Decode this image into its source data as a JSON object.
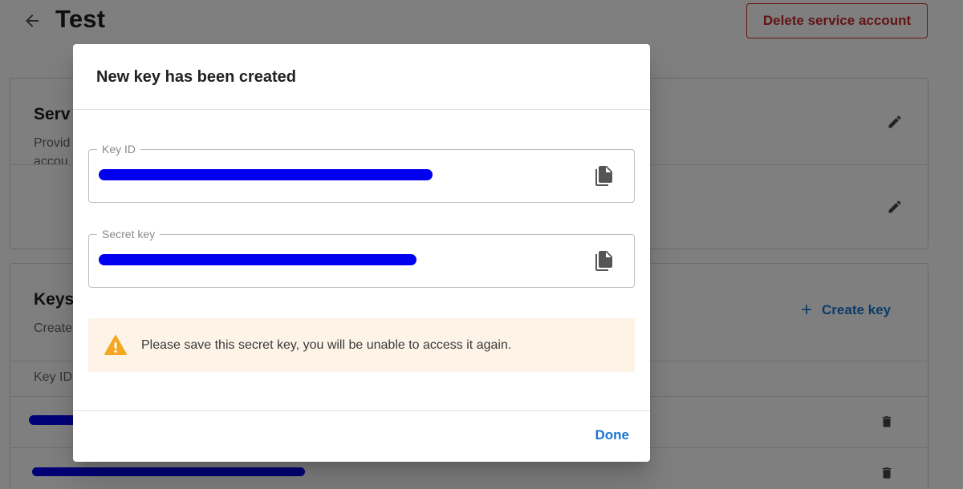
{
  "page": {
    "title": "Test",
    "delete_button": "Delete service account"
  },
  "service_card": {
    "title": "Serv",
    "subtitle_line1": "Provid",
    "subtitle_line2": "accou"
  },
  "keys_card": {
    "title": "Keys",
    "subtitle": "Create",
    "create_key_label": "Create key",
    "create_key_icon": "+",
    "column_header": "Key ID"
  },
  "dialog": {
    "title": "New key has been created",
    "key_id": {
      "label": "Key ID",
      "value": ""
    },
    "secret_key": {
      "label": "Secret key",
      "value": ""
    },
    "warning_text": "Please save this secret key, you will be unable to access it again.",
    "done_label": "Done"
  },
  "colors": {
    "accent": "#1976d2",
    "danger": "#c62828",
    "warning_bg": "#fdf4e7",
    "warning_icon": "#f5a623",
    "redaction": "#0000ee"
  }
}
